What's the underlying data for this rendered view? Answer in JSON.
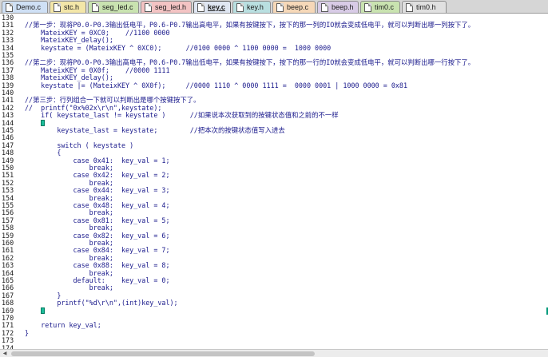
{
  "tabs": [
    {
      "label": "Demo.c",
      "color": "#cfe0f5"
    },
    {
      "label": "stc.h",
      "color": "#f3e6a8"
    },
    {
      "label": "seg_led.c",
      "color": "#c9e3b0"
    },
    {
      "label": "seg_led.h",
      "color": "#f3c3c3"
    },
    {
      "label": "key.c",
      "color": "#dfe6f2"
    },
    {
      "label": "key.h",
      "color": "#b9dfe0"
    },
    {
      "label": "beep.c",
      "color": "#f6d8b8"
    },
    {
      "label": "beep.h",
      "color": "#d8cbe6"
    },
    {
      "label": "tim0.c",
      "color": "#c9e3b0"
    },
    {
      "label": "tim0.h",
      "color": "#e0e0e0"
    }
  ],
  "active_tab": "key.c",
  "code_lines": [
    {
      "n": "130",
      "text": ""
    },
    {
      "n": "131",
      "text": "//第一步：现将P0.0-P0.3输出低电平，P0.6-P0.7输出高电平，如果有按键按下，按下的那一列的IO就会变成低电平，就可以判断出哪一列按下了。"
    },
    {
      "n": "132",
      "text": "    MateixKEY = 0XC0;    //1100 0000"
    },
    {
      "n": "133",
      "text": "    MateixKEY_delay();"
    },
    {
      "n": "134",
      "text": "    keystate = (MateixKEY ^ 0XC0);      //0100 0000 ^ 1100 0000 =  1000 0000"
    },
    {
      "n": "135",
      "text": ""
    },
    {
      "n": "136",
      "text": "//第二步：现将P0.0-P0.3输出高电平，P0.6-P0.7输出低电平，如果有按键按下，按下的那一行的IO就会变成低电平，就可以判断出哪一行按下了。"
    },
    {
      "n": "137",
      "text": "    MateixKEY = 0X0f;    //0000 1111"
    },
    {
      "n": "138",
      "text": "    MateixKEY_delay();"
    },
    {
      "n": "139",
      "text": "    keystate |= (MateixKEY ^ 0X0f);     //0000 1110 ^ 0000 1111 =  0000 0001 | 1000 0000 = 0x81"
    },
    {
      "n": "140",
      "text": ""
    },
    {
      "n": "141",
      "text": "//第三步：行列组合一下就可以判断出是哪个按键按下了。"
    },
    {
      "n": "142",
      "text": "//  printf(\"0x%02x\\r\\n\",keystate);"
    },
    {
      "n": "143",
      "text": "    if( keystate_last != keystate )      //如果说本次获取到的按键状态值和之前的不一样"
    },
    {
      "n": "144",
      "text": "    {",
      "caret": true
    },
    {
      "n": "145",
      "text": "        keystate_last = keystate;        //把本次的按键状态值写入进去"
    },
    {
      "n": "146",
      "text": ""
    },
    {
      "n": "147",
      "text": "        switch ( keystate )"
    },
    {
      "n": "148",
      "text": "        {"
    },
    {
      "n": "149",
      "text": "            case 0x41:  key_val = 1;"
    },
    {
      "n": "150",
      "text": "                break;"
    },
    {
      "n": "151",
      "text": "            case 0x42:  key_val = 2;"
    },
    {
      "n": "152",
      "text": "                break;"
    },
    {
      "n": "153",
      "text": "            case 0x44:  key_val = 3;"
    },
    {
      "n": "154",
      "text": "                break;"
    },
    {
      "n": "155",
      "text": "            case 0x48:  key_val = 4;"
    },
    {
      "n": "156",
      "text": "                break;"
    },
    {
      "n": "157",
      "text": "            case 0x81:  key_val = 5;"
    },
    {
      "n": "158",
      "text": "                break;"
    },
    {
      "n": "159",
      "text": "            case 0x82:  key_val = 6;"
    },
    {
      "n": "160",
      "text": "                break;"
    },
    {
      "n": "161",
      "text": "            case 0x84:  key_val = 7;"
    },
    {
      "n": "162",
      "text": "                break;"
    },
    {
      "n": "163",
      "text": "            case 0x88:  key_val = 8;"
    },
    {
      "n": "164",
      "text": "                break;"
    },
    {
      "n": "165",
      "text": "            default:    key_val = 0;"
    },
    {
      "n": "166",
      "text": "                break;"
    },
    {
      "n": "167",
      "text": "        }"
    },
    {
      "n": "168",
      "text": "        printf(\"%d\\r\\n\",(int)key_val);"
    },
    {
      "n": "169",
      "text": "    }",
      "caret": true,
      "current": true
    },
    {
      "n": "170",
      "text": ""
    },
    {
      "n": "171",
      "text": "    return key_val;"
    },
    {
      "n": "172",
      "text": "}"
    },
    {
      "n": "173",
      "text": ""
    },
    {
      "n": "174",
      "text": ""
    }
  ]
}
